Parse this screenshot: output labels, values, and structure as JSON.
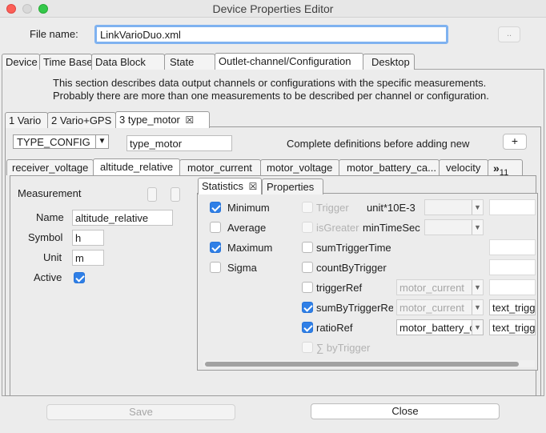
{
  "window": {
    "title": "Device Properties Editor"
  },
  "file": {
    "label": "File name:",
    "value": "LinkVarioDuo.xml",
    "browse_label": ".."
  },
  "main_tabs": [
    "Device",
    "Time Base",
    "Data Block",
    "State",
    "Outlet-channel/Configuration",
    "Desktop"
  ],
  "description": {
    "line1": "This section describes data output channels or configurations with the specific measurements.",
    "line2": "Probably there are more than one measurements to be described per channel or configuration."
  },
  "channel_tabs": [
    "1 Vario",
    "2 Vario+GPS",
    "3 type_motor"
  ],
  "close_tab_glyph": "☒",
  "config": {
    "type": "TYPE_CONFIG",
    "name": "type_motor",
    "hint": "Complete definitions before adding new",
    "add_label": "+"
  },
  "measurement_tabs": [
    "receiver_voltage",
    "altitude_relative",
    "motor_current",
    "motor_voltage",
    "motor_battery_ca...",
    "velocity"
  ],
  "measurement_overflow": {
    "glyph": "»",
    "count": "11"
  },
  "measurement": {
    "section_label": "Measurement",
    "name_label": "Name",
    "name_value": "altitude_relative",
    "symbol_label": "Symbol",
    "symbol_value": "h",
    "unit_label": "Unit",
    "unit_value": "m",
    "active_label": "Active",
    "active": true
  },
  "stat_tabs": [
    "Statistics",
    "Properties"
  ],
  "statistics": {
    "minimum": {
      "label": "Minimum",
      "checked": true
    },
    "average": {
      "label": "Average",
      "checked": false
    },
    "maximum": {
      "label": "Maximum",
      "checked": true
    },
    "sigma": {
      "label": "Sigma",
      "checked": false
    },
    "trigger": {
      "label": "Trigger",
      "checked": false,
      "enabled": false
    },
    "unit_factor_label": "unit*10E-3",
    "is_greater": {
      "label": "isGreater",
      "checked": false,
      "enabled": false
    },
    "min_time_label": "minTimeSec",
    "sum_trigger_time": {
      "label": "sumTriggerTime",
      "checked": false
    },
    "count_by_trigger": {
      "label": "countByTrigger",
      "checked": false
    },
    "trigger_ref": {
      "label": "triggerRef",
      "checked": false,
      "combo": "motor_current"
    },
    "sum_by_trigger_ref": {
      "label": "sumByTriggerRef",
      "checked": true,
      "combo": "motor_current",
      "text": "text_trigger"
    },
    "ratio_ref": {
      "label": "ratioRef",
      "checked": true,
      "combo": "motor_battery_c",
      "text": "text_trigger"
    },
    "sigma_by_trigger": {
      "label": "∑ byTrigger",
      "checked": false,
      "enabled": false
    }
  },
  "buttons": {
    "save": "Save",
    "close": "Close"
  },
  "colors": {
    "accent": "#2f7fe6",
    "focus": "#7fb2f0"
  }
}
